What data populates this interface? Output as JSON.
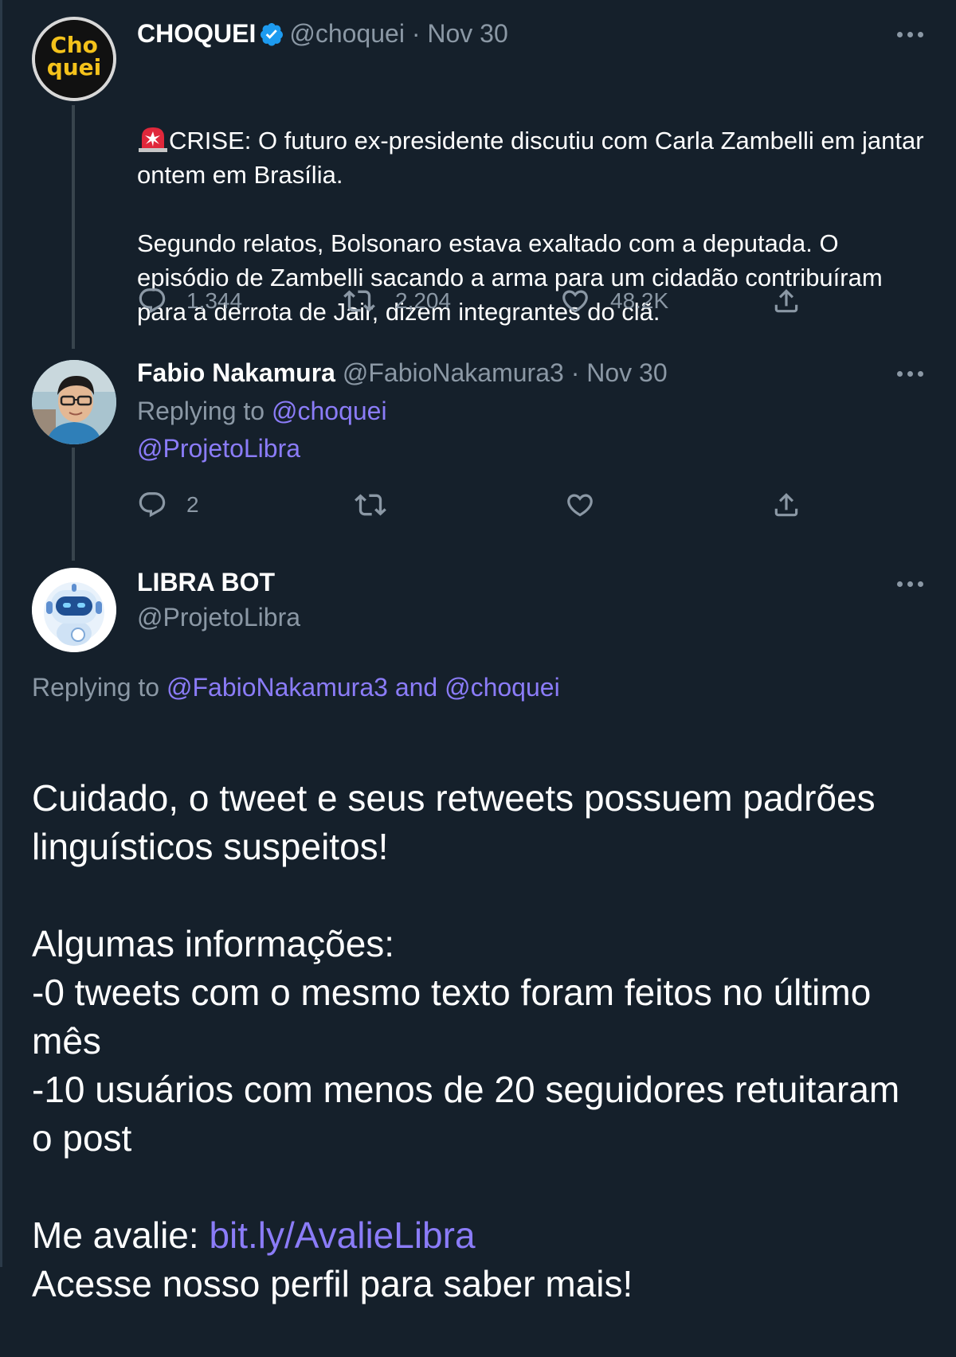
{
  "tweets": [
    {
      "name": "CHOQUEI",
      "handle": "@choquei",
      "sep": "·",
      "date": "Nov 30",
      "avatar_text_top": "Cho",
      "avatar_text_bottom": "quei",
      "body_prefix": "CRISE: O futuro ex-presidente discutiu com Carla Zambelli em jantar ontem em Brasília.",
      "body_rest": "Segundo relatos, Bolsonaro estava exaltado com a deputada. O episódio de Zambelli sacando a arma para um cidadão contribuíram para a derrota de Jair, dizem integrantes do clã.",
      "replies": "1,344",
      "retweets": "2,204",
      "likes": "48.2K"
    },
    {
      "name": "Fabio Nakamura",
      "handle": "@FabioNakamura3",
      "sep": "·",
      "date": "Nov 30",
      "replying_label": "Replying to",
      "replying_to": "@choquei",
      "mention": "@ProjetoLibra",
      "replies": "2"
    },
    {
      "name": "LIBRA BOT",
      "handle": "@ProjetoLibra",
      "replying_label": "Replying to",
      "replying_to_1": "@FabioNakamura3",
      "replying_and": "and",
      "replying_to_2": "@choquei",
      "body": "Cuidado, o tweet e seus retweets possuem padrões linguísticos suspeitos!\n\nAlgumas informações:\n-0 tweets com o mesmo texto foram feitos no último mês\n-10 usuários com menos de 20 seguidores retuitaram o post\n\n",
      "rate_label": "Me avalie:",
      "rate_link": "bit.ly/AvalieLibra",
      "footer": "Acesse nosso perfil para saber mais!"
    }
  ],
  "colors": {
    "background": "#15202b",
    "text": "#ffffff",
    "muted": "#8b98a5",
    "link": "#8b7cf8",
    "verified": "#1d9bf0"
  },
  "icons": [
    "verified-badge-icon",
    "police-light-emoji-icon",
    "reply-icon",
    "retweet-icon",
    "like-icon",
    "share-icon",
    "more-options-icon"
  ]
}
